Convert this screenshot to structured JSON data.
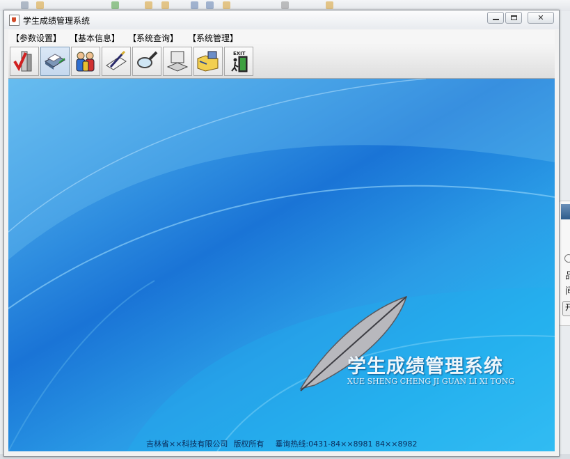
{
  "window": {
    "title": "学生成绩管理系统",
    "controls": {
      "minimize": "",
      "maximize": "",
      "close": "✕"
    }
  },
  "menu": [
    {
      "label": "【参数设置】"
    },
    {
      "label": "【基本信息】"
    },
    {
      "label": "【系统查询】"
    },
    {
      "label": "【系统管理】"
    }
  ],
  "toolbar": [
    {
      "icon": "checklist-icon"
    },
    {
      "icon": "printer-icon"
    },
    {
      "icon": "users-icon"
    },
    {
      "icon": "edit-pen-icon"
    },
    {
      "icon": "magnifier-icon"
    },
    {
      "icon": "computer-icon"
    },
    {
      "icon": "folder-network-icon"
    },
    {
      "icon": "exit-icon",
      "label": "EXIT"
    }
  ],
  "banner": {
    "title": "学生成绩管理系统",
    "subtitle": "XUE SHENG CHENG JI GUAN LI XI TONG"
  },
  "footer": {
    "company": "吉林省××科技有限公司",
    "rights": "版权所有",
    "hotline": "垂询热线:0431-84××8981 84××8982"
  },
  "side_panel": {
    "texts": [
      "品",
      "间",
      "开"
    ]
  },
  "colors": {
    "accent_blue": "#1a74d6",
    "light_blue": "#3cc3f5",
    "footer_text": "#0a2c5a"
  }
}
